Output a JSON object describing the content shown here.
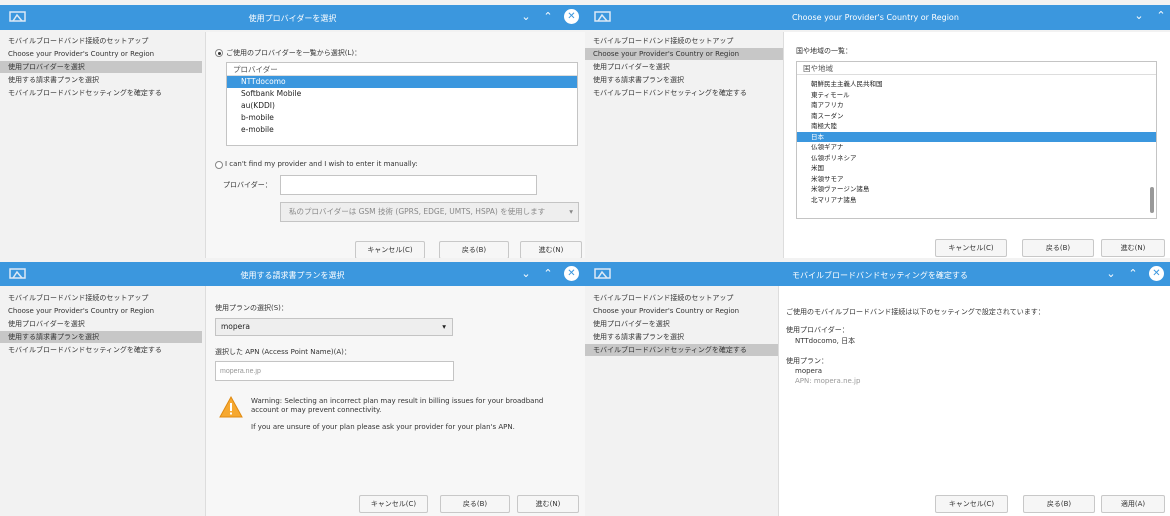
{
  "sidebar_items": [
    "モバイルブロードバンド接続のセットアップ",
    "Choose your Provider's Country or Region",
    "使用プロバイダーを選択",
    "使用する請求書プランを選択",
    "モバイルブロードバンドセッティングを確定する"
  ],
  "buttons": {
    "cancel": "キャンセル(C)",
    "back": "戻る(B)",
    "next": "進む(N)",
    "apply": "適用(A)"
  },
  "w1": {
    "title": "使用プロバイダーを選択",
    "radio_list_label": "ご使用のプロバイダーを一覧から選択(L)：",
    "list_header": "プロバイダー",
    "providers": [
      "NTTdocomo",
      "Softbank Mobile",
      "au(KDDI)",
      "b-mobile",
      "e-mobile"
    ],
    "selected_provider": "NTTdocomo",
    "radio_manual_label": "I can't find my provider and I wish to enter it manually:",
    "provider_field_label": "プロバイダー：",
    "provider_field_value": "",
    "tech_select": "私のプロバイダーは GSM 技術 (GPRS, EDGE, UMTS, HSPA) を使用します"
  },
  "w2": {
    "title": "Choose your Provider's Country or Region",
    "list_label": "国や地域の一覧：",
    "list_header": "国や地域",
    "countries": [
      "朝鮮民主主義人民共和国",
      "東ティモール",
      "南アフリカ",
      "南スーダン",
      "南極大陸",
      "日本",
      "仏領ギアナ",
      "仏領ポリネシア",
      "米国",
      "米領サモア",
      "米領ヴァージン諸島",
      "北マリアナ諸島"
    ],
    "selected_country": "日本"
  },
  "w3": {
    "title": "使用する請求書プランを選択",
    "plan_label": "使用プランの選択(S)：",
    "plan_value": "mopera",
    "apn_label": "選択した APN (Access Point Name)(A)：",
    "apn_value": "mopera.ne.jp",
    "warning_text": "Warning: Selecting an incorrect plan may result in billing issues for your broadband account or may prevent connectivity.",
    "unsure_text": "If you are unsure of your plan please ask your provider for your plan's APN."
  },
  "w4": {
    "title": "モバイルブロードバンドセッティングを確定する",
    "intro": "ご使用のモバイルブロードバンド接続は以下のセッティングで設定されています：",
    "provider_label": "使用プロバイダー：",
    "provider_value": "NTTdocomo, 日本",
    "plan_label": "使用プラン：",
    "plan_value": "mopera",
    "apn_text": "APN: mopera.ne.jp"
  }
}
